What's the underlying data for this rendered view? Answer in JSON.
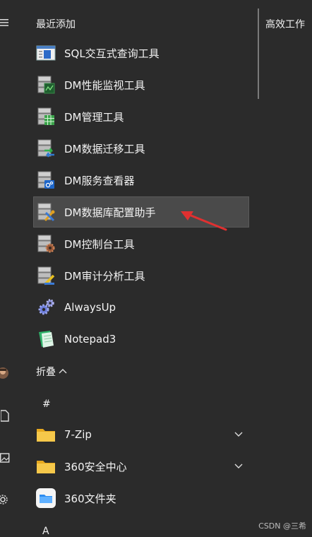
{
  "left_rail": {
    "icons": [
      "menu-icon",
      "avatar",
      "document-icon",
      "photo-icon",
      "gear-icon"
    ]
  },
  "recent": {
    "header": "最近添加",
    "items": [
      {
        "label": "SQL交互式查询工具",
        "icon": "sql-tool-icon"
      },
      {
        "label": "DM性能监视工具",
        "icon": "monitor-tool-icon"
      },
      {
        "label": "DM管理工具",
        "icon": "manage-tool-icon"
      },
      {
        "label": "DM数据迁移工具",
        "icon": "migrate-tool-icon"
      },
      {
        "label": "DM服务查看器",
        "icon": "service-viewer-icon"
      },
      {
        "label": "DM数据库配置助手",
        "icon": "config-assistant-icon"
      },
      {
        "label": "DM控制台工具",
        "icon": "console-tool-icon"
      },
      {
        "label": "DM审计分析工具",
        "icon": "audit-tool-icon"
      },
      {
        "label": "AlwaysUp",
        "icon": "gears-icon"
      },
      {
        "label": "Notepad3",
        "icon": "notepad-icon"
      }
    ]
  },
  "collapse": {
    "label": "折叠"
  },
  "sections": {
    "hash_header": "#",
    "a_header": "A"
  },
  "folders": [
    {
      "label": "7-Zip",
      "icon": "folder-icon"
    },
    {
      "label": "360安全中心",
      "icon": "folder-icon"
    },
    {
      "label": "360文件夹",
      "icon": "360-folder-icon"
    }
  ],
  "tiles": {
    "group_title": "高效工作"
  },
  "watermark": "CSDN @三希",
  "colors": {
    "background": "#2b2b2b",
    "highlight": "#4a4a4a",
    "arrow": "#e03030",
    "folder": "#f4c430"
  }
}
